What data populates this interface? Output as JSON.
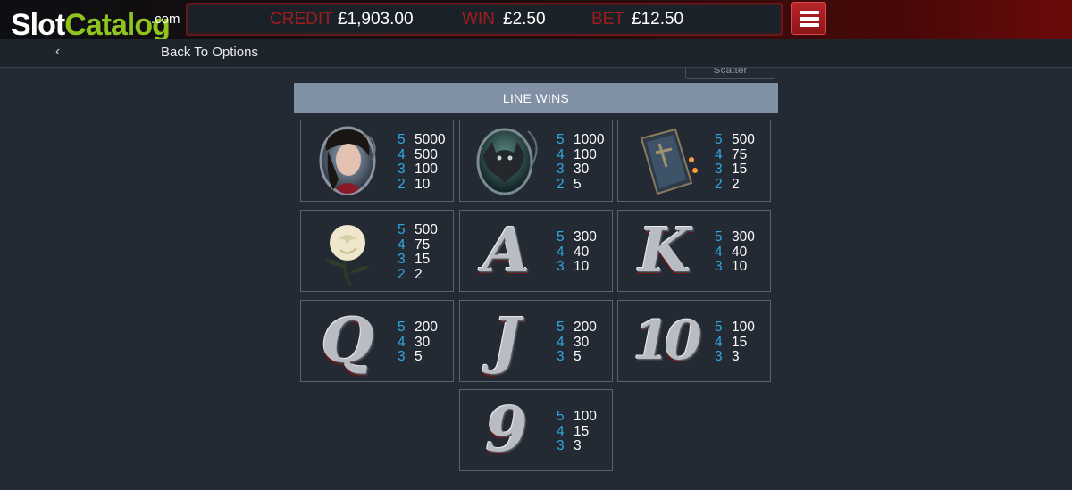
{
  "header": {
    "logo": {
      "slot": "Slot",
      "catalog": "Catalog",
      "com": ".com"
    },
    "credit_label": "CREDIT",
    "credit_value": "£1,903.00",
    "win_label": "WIN",
    "win_value": "£2.50",
    "bet_label": "BET",
    "bet_value": "£12.50",
    "menu_icon": "hamburger-menu-icon"
  },
  "nav": {
    "back_icon": "chevron-left-icon",
    "back_label": "Back To Options",
    "scatter_tab": "Scatter"
  },
  "paytable": {
    "section_title": "LINE WINS",
    "symbols": [
      {
        "symbol": "lady",
        "pays": [
          {
            "count": "5",
            "value": "5000"
          },
          {
            "count": "4",
            "value": "500"
          },
          {
            "count": "3",
            "value": "100"
          },
          {
            "count": "2",
            "value": "10"
          }
        ]
      },
      {
        "symbol": "bat",
        "pays": [
          {
            "count": "5",
            "value": "1000"
          },
          {
            "count": "4",
            "value": "100"
          },
          {
            "count": "3",
            "value": "30"
          },
          {
            "count": "2",
            "value": "5"
          }
        ]
      },
      {
        "symbol": "coffin",
        "pays": [
          {
            "count": "5",
            "value": "500"
          },
          {
            "count": "4",
            "value": "75"
          },
          {
            "count": "3",
            "value": "15"
          },
          {
            "count": "2",
            "value": "2"
          }
        ]
      },
      {
        "symbol": "white-rose",
        "pays": [
          {
            "count": "5",
            "value": "500"
          },
          {
            "count": "4",
            "value": "75"
          },
          {
            "count": "3",
            "value": "15"
          },
          {
            "count": "2",
            "value": "2"
          }
        ]
      },
      {
        "symbol": "A",
        "pays": [
          {
            "count": "5",
            "value": "300"
          },
          {
            "count": "4",
            "value": "40"
          },
          {
            "count": "3",
            "value": "10"
          }
        ]
      },
      {
        "symbol": "K",
        "pays": [
          {
            "count": "5",
            "value": "300"
          },
          {
            "count": "4",
            "value": "40"
          },
          {
            "count": "3",
            "value": "10"
          }
        ]
      },
      {
        "symbol": "Q",
        "pays": [
          {
            "count": "5",
            "value": "200"
          },
          {
            "count": "4",
            "value": "30"
          },
          {
            "count": "3",
            "value": "5"
          }
        ]
      },
      {
        "symbol": "J",
        "pays": [
          {
            "count": "5",
            "value": "200"
          },
          {
            "count": "4",
            "value": "30"
          },
          {
            "count": "3",
            "value": "5"
          }
        ]
      },
      {
        "symbol": "10",
        "pays": [
          {
            "count": "5",
            "value": "100"
          },
          {
            "count": "4",
            "value": "15"
          },
          {
            "count": "3",
            "value": "3"
          }
        ]
      },
      {
        "symbol": "9",
        "pays": [
          {
            "count": "5",
            "value": "100"
          },
          {
            "count": "4",
            "value": "15"
          },
          {
            "count": "3",
            "value": "3"
          }
        ]
      }
    ]
  },
  "colors": {
    "accent_red": "#a01c1c",
    "count_blue": "#2fa8e0",
    "header_bar": "#8090a5",
    "logo_green": "#8fc31f"
  }
}
